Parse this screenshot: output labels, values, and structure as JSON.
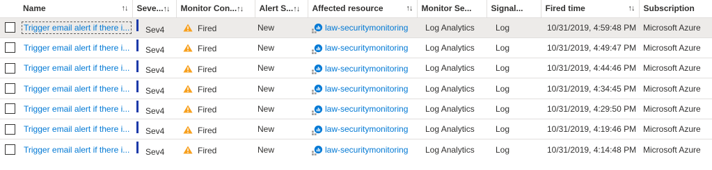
{
  "columns": {
    "name": "Name",
    "severity": "Seve...",
    "monitor_condition": "Monitor Con...",
    "alert_state": "Alert S...",
    "affected_resource": "Affected resource",
    "monitor_service": "Monitor Se...",
    "signal_type": "Signal...",
    "fired_time": "Fired time",
    "subscription": "Subscription",
    "sort_glyph": "↑↓"
  },
  "rows": [
    {
      "name": "Trigger email alert if there i...",
      "severity": "Sev4",
      "condition": "Fired",
      "state": "New",
      "resource": "law-securitymonitoring",
      "service": "Log Analytics",
      "signal": "Log",
      "time": "10/31/2019, 4:59:48 PM",
      "subscription": "Microsoft Azure",
      "selected": true
    },
    {
      "name": "Trigger email alert if there i...",
      "severity": "Sev4",
      "condition": "Fired",
      "state": "New",
      "resource": "law-securitymonitoring",
      "service": "Log Analytics",
      "signal": "Log",
      "time": "10/31/2019, 4:49:47 PM",
      "subscription": "Microsoft Azure",
      "selected": false
    },
    {
      "name": "Trigger email alert if there i...",
      "severity": "Sev4",
      "condition": "Fired",
      "state": "New",
      "resource": "law-securitymonitoring",
      "service": "Log Analytics",
      "signal": "Log",
      "time": "10/31/2019, 4:44:46 PM",
      "subscription": "Microsoft Azure",
      "selected": false
    },
    {
      "name": "Trigger email alert if there i...",
      "severity": "Sev4",
      "condition": "Fired",
      "state": "New",
      "resource": "law-securitymonitoring",
      "service": "Log Analytics",
      "signal": "Log",
      "time": "10/31/2019, 4:34:45 PM",
      "subscription": "Microsoft Azure",
      "selected": false
    },
    {
      "name": "Trigger email alert if there i...",
      "severity": "Sev4",
      "condition": "Fired",
      "state": "New",
      "resource": "law-securitymonitoring",
      "service": "Log Analytics",
      "signal": "Log",
      "time": "10/31/2019, 4:29:50 PM",
      "subscription": "Microsoft Azure",
      "selected": false
    },
    {
      "name": "Trigger email alert if there i...",
      "severity": "Sev4",
      "condition": "Fired",
      "state": "New",
      "resource": "law-securitymonitoring",
      "service": "Log Analytics",
      "signal": "Log",
      "time": "10/31/2019, 4:19:46 PM",
      "subscription": "Microsoft Azure",
      "selected": false
    },
    {
      "name": "Trigger email alert if there i...",
      "severity": "Sev4",
      "condition": "Fired",
      "state": "New",
      "resource": "law-securitymonitoring",
      "service": "Log Analytics",
      "signal": "Log",
      "time": "10/31/2019, 4:14:48 PM",
      "subscription": "Microsoft Azure",
      "selected": false
    }
  ],
  "icons": {
    "warning": "warning-triangle-icon",
    "resource": "log-analytics-workspace-icon"
  },
  "colors": {
    "link": "#0078d4",
    "severity_bar": "#1c3aa9",
    "warning": "#f7a01e",
    "selected_row": "#edebe9"
  }
}
